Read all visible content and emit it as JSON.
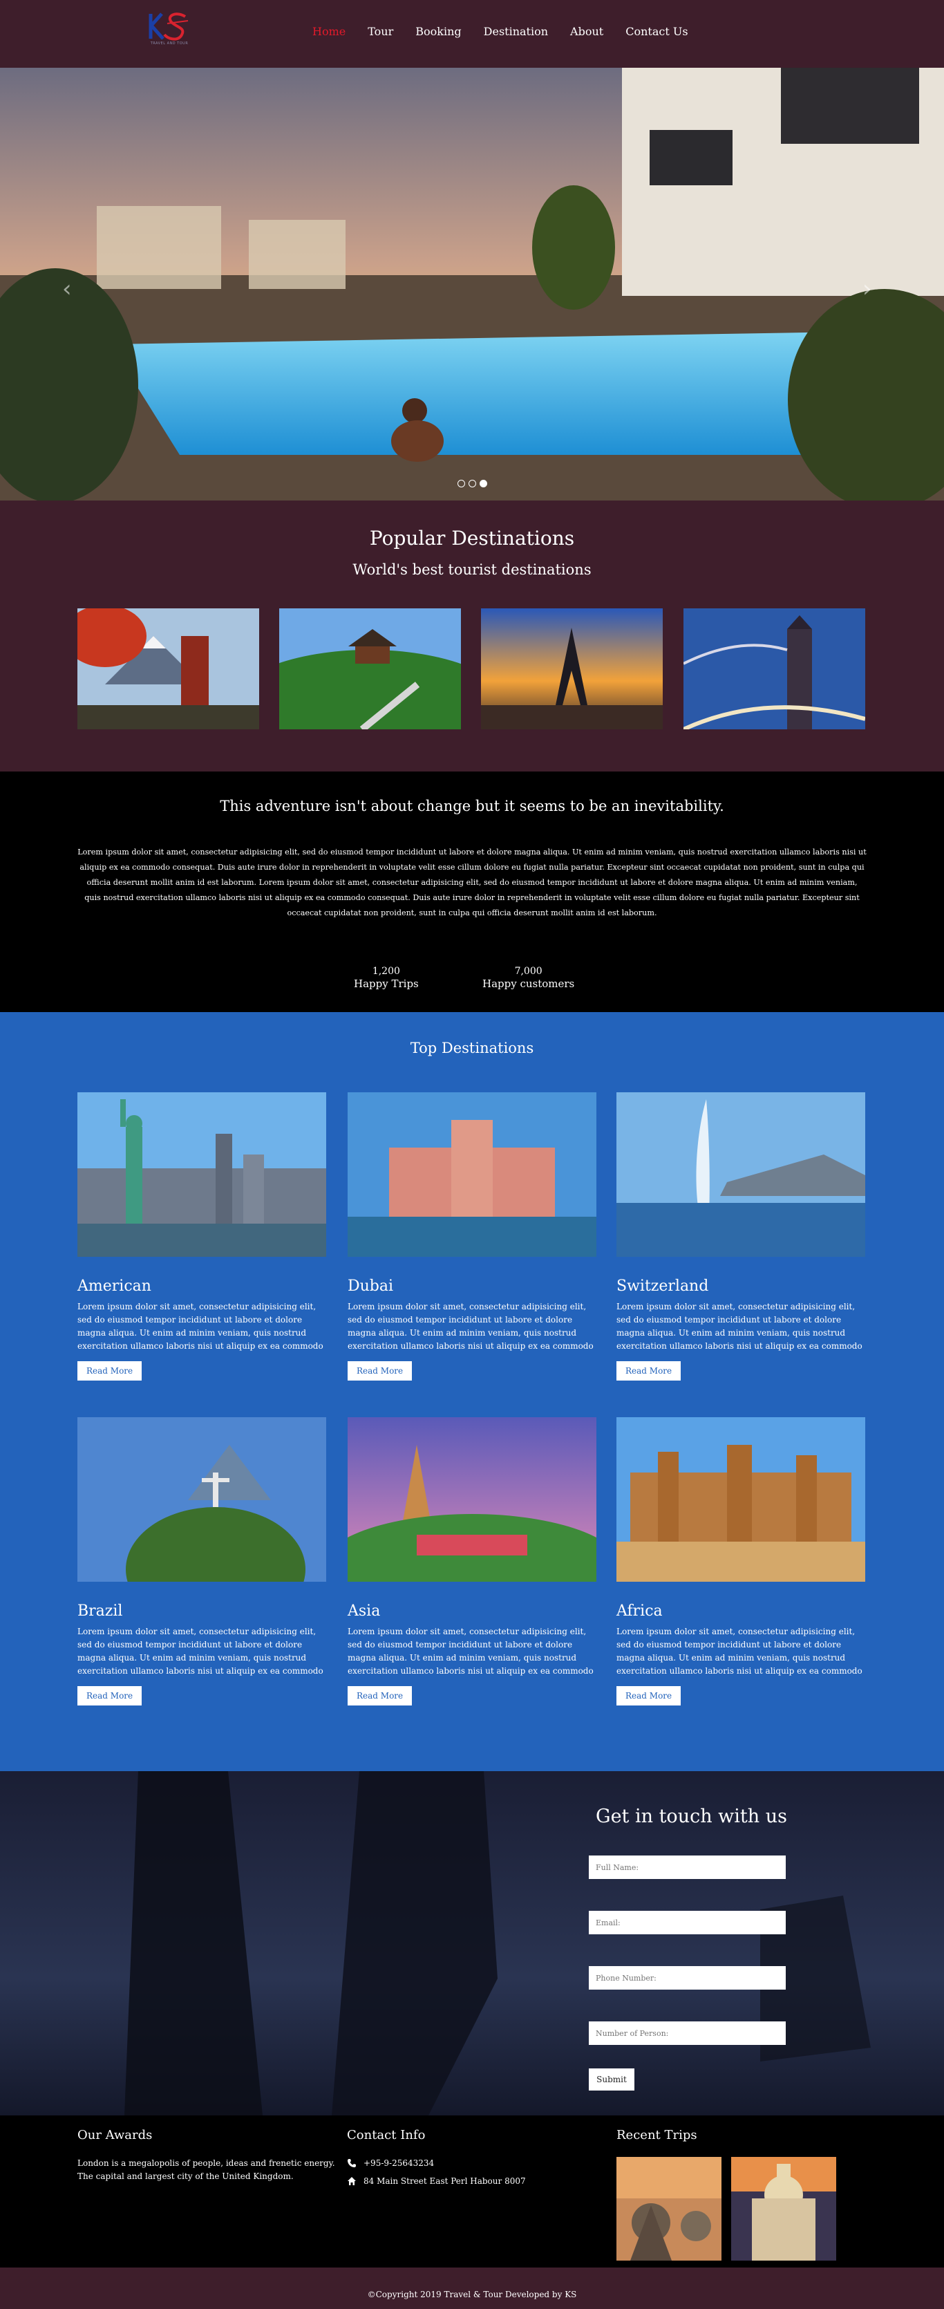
{
  "nav": {
    "logo_text": "TRAVEL AND TOUR",
    "items": [
      {
        "label": "Home",
        "active": true
      },
      {
        "label": "Tour"
      },
      {
        "label": "Booking"
      },
      {
        "label": "Destination"
      },
      {
        "label": "About"
      },
      {
        "label": "Contact Us"
      }
    ]
  },
  "hero": {
    "prev_icon": "chevron-left-icon",
    "next_icon": "chevron-right-icon",
    "slides": 3,
    "active_slide": 3
  },
  "popular": {
    "title": "Popular Destinations",
    "subtitle": "World's best tourist destinations",
    "images": [
      "Mount Fuji pagoda",
      "Korean garden pavilion",
      "Eiffel Tower sunset",
      "Tower Bridge"
    ]
  },
  "adventure": {
    "title": "This adventure isn't about change but it seems to be an inevitability.",
    "text": "Lorem ipsum dolor sit amet, consectetur adipisicing elit, sed do eiusmod tempor incididunt ut labore et dolore magna aliqua. Ut enim ad minim veniam, quis nostrud exercitation ullamco laboris nisi ut aliquip ex ea commodo consequat. Duis aute irure dolor in reprehenderit in voluptate velit esse cillum dolore eu fugiat nulla pariatur. Excepteur sint occaecat cupidatat non proident, sunt in culpa qui officia deserunt mollit anim id est laborum. Lorem ipsum dolor sit amet, consectetur adipisicing elit, sed do eiusmod tempor incididunt ut labore et dolore magna aliqua. Ut enim ad minim veniam, quis nostrud exercitation ullamco laboris nisi ut aliquip ex ea commodo consequat. Duis aute irure dolor in reprehenderit in voluptate velit esse cillum dolore eu fugiat nulla pariatur. Excepteur sint occaecat cupidatat non proident, sunt in culpa qui officia deserunt mollit anim id est laborum.",
    "stats": [
      {
        "number": "1,200",
        "label": "Happy Trips"
      },
      {
        "number": "7,000",
        "label": "Happy customers"
      }
    ]
  },
  "top": {
    "title": "Top Destinations",
    "button_label": "Read More",
    "body": "Lorem ipsum dolor sit amet, consectetur adipisicing elit, sed do eiusmod tempor incididunt ut labore et dolore magna aliqua. Ut enim ad minim veniam, quis nostrud exercitation ullamco laboris nisi ut aliquip ex ea commodo",
    "cards": [
      {
        "name": "American"
      },
      {
        "name": "Dubai"
      },
      {
        "name": "Switzerland"
      },
      {
        "name": "Brazil"
      },
      {
        "name": "Asia"
      },
      {
        "name": "Africa"
      }
    ]
  },
  "contact": {
    "title": "Get in touch with us",
    "fields": [
      "Full Name:",
      "Email:",
      "Phone Number:",
      "Number of Person:"
    ],
    "submit": "Submit"
  },
  "footer": {
    "awards_title": "Our Awards",
    "awards_text": "London is a megalopolis of people, ideas and frenetic energy. The capital and largest city of the United Kingdom.",
    "contact_title": "Contact Info",
    "phone": "+95-9-25643234",
    "address": "84 Main Street East Perl Habour 8007",
    "phone_icon": "phone-icon",
    "home_icon": "home-icon",
    "trips_title": "Recent Trips",
    "copyright": "©Copyright 2019 Travel & Tour Developed by KS"
  }
}
